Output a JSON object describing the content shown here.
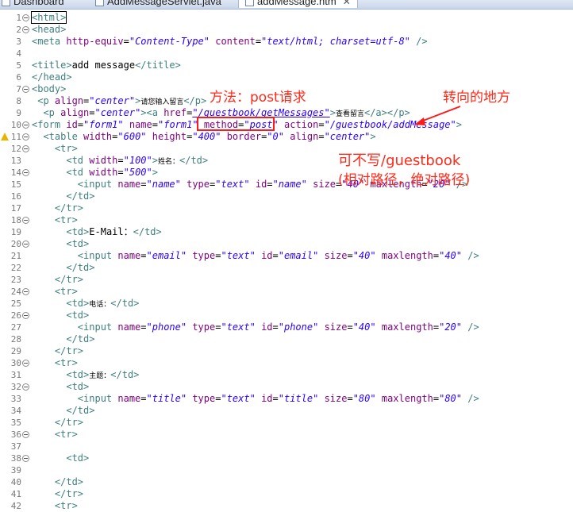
{
  "tabs": [
    {
      "label": "Dashboard",
      "active": false
    },
    {
      "label": "AddMessageServlet.java",
      "active": false
    },
    {
      "label": "addMessage.htm",
      "active": true,
      "close": "✕"
    }
  ],
  "lines": [
    {
      "n": "1",
      "fold": true,
      "segs": [
        {
          "c": "t",
          "x": "<html>"
        }
      ]
    },
    {
      "n": "2",
      "fold": true,
      "segs": [
        {
          "c": "t",
          "x": "<head>"
        }
      ]
    },
    {
      "n": "3",
      "segs": [
        {
          "c": "t",
          "x": "<meta "
        },
        {
          "c": "a",
          "x": "http-equiv"
        },
        {
          "c": "tx",
          "x": "="
        },
        {
          "c": "v",
          "x": "\"Content-Type\""
        },
        {
          "c": "tx",
          "x": " "
        },
        {
          "c": "a",
          "x": "content"
        },
        {
          "c": "tx",
          "x": "="
        },
        {
          "c": "v",
          "x": "\"text/html; charset=utf-8\""
        },
        {
          "c": "t",
          "x": " />"
        }
      ]
    },
    {
      "n": "4",
      "segs": []
    },
    {
      "n": "5",
      "segs": [
        {
          "c": "t",
          "x": "<title>"
        },
        {
          "c": "tx",
          "x": "add message"
        },
        {
          "c": "t",
          "x": "</title>"
        }
      ]
    },
    {
      "n": "6",
      "segs": [
        {
          "c": "t",
          "x": "</head>"
        }
      ]
    },
    {
      "n": "7",
      "fold": true,
      "segs": [
        {
          "c": "t",
          "x": "<body>"
        }
      ]
    },
    {
      "n": "8",
      "segs": [
        {
          "c": "tx",
          "x": " "
        },
        {
          "c": "t",
          "x": "<p "
        },
        {
          "c": "a",
          "x": "align"
        },
        {
          "c": "tx",
          "x": "="
        },
        {
          "c": "v",
          "x": "\"center\""
        },
        {
          "c": "t",
          "x": ">"
        },
        {
          "c": "tx sm",
          "x": "请您输入留言"
        },
        {
          "c": "t",
          "x": "</p>"
        }
      ]
    },
    {
      "n": "9",
      "segs": [
        {
          "c": "tx",
          "x": "  "
        },
        {
          "c": "t",
          "x": "<p "
        },
        {
          "c": "a",
          "x": "align"
        },
        {
          "c": "tx",
          "x": "="
        },
        {
          "c": "v",
          "x": "\"center\""
        },
        {
          "c": "t",
          "x": "><a "
        },
        {
          "c": "a",
          "x": "href"
        },
        {
          "c": "tx",
          "x": "="
        },
        {
          "c": "v ul",
          "x": "\"/guestbook/getMessages\""
        },
        {
          "c": "t",
          "x": ">"
        },
        {
          "c": "tx sm",
          "x": "查看留言"
        },
        {
          "c": "t",
          "x": "</a></p>"
        }
      ]
    },
    {
      "n": "10",
      "fold": true,
      "segs": [
        {
          "c": "t",
          "x": "<form "
        },
        {
          "c": "a",
          "x": "id"
        },
        {
          "c": "tx",
          "x": "="
        },
        {
          "c": "v",
          "x": "\"form1\""
        },
        {
          "c": "tx",
          "x": " "
        },
        {
          "c": "a",
          "x": "name"
        },
        {
          "c": "tx",
          "x": "="
        },
        {
          "c": "v",
          "x": "\"form1\""
        },
        {
          "c": "tx",
          "x": " "
        },
        {
          "c": "a",
          "x": "method"
        },
        {
          "c": "tx",
          "x": "="
        },
        {
          "c": "v",
          "x": "\"post\""
        },
        {
          "c": "tx",
          "x": " "
        },
        {
          "c": "a",
          "x": "action"
        },
        {
          "c": "tx",
          "x": "="
        },
        {
          "c": "v",
          "x": "\"/guestbook/addMessage\""
        },
        {
          "c": "t",
          "x": ">"
        }
      ]
    },
    {
      "n": "11",
      "fold": true,
      "warn": true,
      "segs": [
        {
          "c": "tx",
          "x": "  "
        },
        {
          "c": "t",
          "x": "<table "
        },
        {
          "c": "a",
          "x": "width"
        },
        {
          "c": "tx",
          "x": "="
        },
        {
          "c": "v",
          "x": "\"600\""
        },
        {
          "c": "tx",
          "x": " "
        },
        {
          "c": "a",
          "x": "height"
        },
        {
          "c": "tx",
          "x": "="
        },
        {
          "c": "v",
          "x": "\"400\""
        },
        {
          "c": "tx",
          "x": " "
        },
        {
          "c": "a",
          "x": "border"
        },
        {
          "c": "tx",
          "x": "="
        },
        {
          "c": "v",
          "x": "\"0\""
        },
        {
          "c": "tx",
          "x": " "
        },
        {
          "c": "a",
          "x": "align"
        },
        {
          "c": "tx",
          "x": "="
        },
        {
          "c": "v",
          "x": "\"center\""
        },
        {
          "c": "t",
          "x": ">"
        }
      ]
    },
    {
      "n": "12",
      "fold": true,
      "segs": [
        {
          "c": "tx",
          "x": "    "
        },
        {
          "c": "t",
          "x": "<tr>"
        }
      ]
    },
    {
      "n": "13",
      "segs": [
        {
          "c": "tx",
          "x": "      "
        },
        {
          "c": "t",
          "x": "<td "
        },
        {
          "c": "a",
          "x": "width"
        },
        {
          "c": "tx",
          "x": "="
        },
        {
          "c": "v",
          "x": "\"100\""
        },
        {
          "c": "t",
          "x": ">"
        },
        {
          "c": "tx sm",
          "x": "姓名："
        },
        {
          "c": "t",
          "x": "</td>"
        }
      ]
    },
    {
      "n": "14",
      "fold": true,
      "segs": [
        {
          "c": "tx",
          "x": "      "
        },
        {
          "c": "t",
          "x": "<td "
        },
        {
          "c": "a",
          "x": "width"
        },
        {
          "c": "tx",
          "x": "="
        },
        {
          "c": "v",
          "x": "\"500\""
        },
        {
          "c": "t",
          "x": ">"
        }
      ]
    },
    {
      "n": "15",
      "segs": [
        {
          "c": "tx",
          "x": "        "
        },
        {
          "c": "t",
          "x": "<input "
        },
        {
          "c": "a",
          "x": "name"
        },
        {
          "c": "tx",
          "x": "="
        },
        {
          "c": "v",
          "x": "\"name\""
        },
        {
          "c": "tx",
          "x": " "
        },
        {
          "c": "a",
          "x": "type"
        },
        {
          "c": "tx",
          "x": "="
        },
        {
          "c": "v",
          "x": "\"text\""
        },
        {
          "c": "tx",
          "x": " "
        },
        {
          "c": "a",
          "x": "id"
        },
        {
          "c": "tx",
          "x": "="
        },
        {
          "c": "v",
          "x": "\"name\""
        },
        {
          "c": "tx",
          "x": " "
        },
        {
          "c": "a",
          "x": "size"
        },
        {
          "c": "tx",
          "x": "="
        },
        {
          "c": "v",
          "x": "\"40\""
        },
        {
          "c": "tx",
          "x": " "
        },
        {
          "c": "a",
          "x": "maxlength"
        },
        {
          "c": "tx",
          "x": "="
        },
        {
          "c": "v",
          "x": "\"20\""
        },
        {
          "c": "t",
          "x": " />"
        }
      ]
    },
    {
      "n": "16",
      "segs": [
        {
          "c": "tx",
          "x": "      "
        },
        {
          "c": "t",
          "x": "</td>"
        }
      ]
    },
    {
      "n": "17",
      "segs": [
        {
          "c": "tx",
          "x": "    "
        },
        {
          "c": "t",
          "x": "</tr>"
        }
      ]
    },
    {
      "n": "18",
      "fold": true,
      "segs": [
        {
          "c": "tx",
          "x": "    "
        },
        {
          "c": "t",
          "x": "<tr>"
        }
      ]
    },
    {
      "n": "19",
      "segs": [
        {
          "c": "tx",
          "x": "      "
        },
        {
          "c": "t",
          "x": "<td>"
        },
        {
          "c": "tx",
          "x": "E-Mail："
        },
        {
          "c": "t",
          "x": "</td>"
        }
      ]
    },
    {
      "n": "20",
      "fold": true,
      "segs": [
        {
          "c": "tx",
          "x": "      "
        },
        {
          "c": "t",
          "x": "<td>"
        }
      ]
    },
    {
      "n": "21",
      "segs": [
        {
          "c": "tx",
          "x": "        "
        },
        {
          "c": "t",
          "x": "<input "
        },
        {
          "c": "a",
          "x": "name"
        },
        {
          "c": "tx",
          "x": "="
        },
        {
          "c": "v",
          "x": "\"email\""
        },
        {
          "c": "tx",
          "x": " "
        },
        {
          "c": "a",
          "x": "type"
        },
        {
          "c": "tx",
          "x": "="
        },
        {
          "c": "v",
          "x": "\"text\""
        },
        {
          "c": "tx",
          "x": " "
        },
        {
          "c": "a",
          "x": "id"
        },
        {
          "c": "tx",
          "x": "="
        },
        {
          "c": "v",
          "x": "\"email\""
        },
        {
          "c": "tx",
          "x": " "
        },
        {
          "c": "a",
          "x": "size"
        },
        {
          "c": "tx",
          "x": "="
        },
        {
          "c": "v",
          "x": "\"40\""
        },
        {
          "c": "tx",
          "x": " "
        },
        {
          "c": "a",
          "x": "maxlength"
        },
        {
          "c": "tx",
          "x": "="
        },
        {
          "c": "v",
          "x": "\"40\""
        },
        {
          "c": "t",
          "x": " />"
        }
      ]
    },
    {
      "n": "22",
      "segs": [
        {
          "c": "tx",
          "x": "      "
        },
        {
          "c": "t",
          "x": "</td>"
        }
      ]
    },
    {
      "n": "23",
      "segs": [
        {
          "c": "tx",
          "x": "    "
        },
        {
          "c": "t",
          "x": "</tr>"
        }
      ]
    },
    {
      "n": "24",
      "fold": true,
      "segs": [
        {
          "c": "tx",
          "x": "    "
        },
        {
          "c": "t",
          "x": "<tr>"
        }
      ]
    },
    {
      "n": "25",
      "segs": [
        {
          "c": "tx",
          "x": "      "
        },
        {
          "c": "t",
          "x": "<td>"
        },
        {
          "c": "tx sm",
          "x": "电话："
        },
        {
          "c": "t",
          "x": "</td>"
        }
      ]
    },
    {
      "n": "26",
      "fold": true,
      "segs": [
        {
          "c": "tx",
          "x": "      "
        },
        {
          "c": "t",
          "x": "<td>"
        }
      ]
    },
    {
      "n": "27",
      "segs": [
        {
          "c": "tx",
          "x": "        "
        },
        {
          "c": "t",
          "x": "<input "
        },
        {
          "c": "a",
          "x": "name"
        },
        {
          "c": "tx",
          "x": "="
        },
        {
          "c": "v",
          "x": "\"phone\""
        },
        {
          "c": "tx",
          "x": " "
        },
        {
          "c": "a",
          "x": "type"
        },
        {
          "c": "tx",
          "x": "="
        },
        {
          "c": "v",
          "x": "\"text\""
        },
        {
          "c": "tx",
          "x": " "
        },
        {
          "c": "a",
          "x": "id"
        },
        {
          "c": "tx",
          "x": "="
        },
        {
          "c": "v",
          "x": "\"phone\""
        },
        {
          "c": "tx",
          "x": " "
        },
        {
          "c": "a",
          "x": "size"
        },
        {
          "c": "tx",
          "x": "="
        },
        {
          "c": "v",
          "x": "\"40\""
        },
        {
          "c": "tx",
          "x": " "
        },
        {
          "c": "a",
          "x": "maxlength"
        },
        {
          "c": "tx",
          "x": "="
        },
        {
          "c": "v",
          "x": "\"20\""
        },
        {
          "c": "t",
          "x": " />"
        }
      ]
    },
    {
      "n": "28",
      "segs": [
        {
          "c": "tx",
          "x": "      "
        },
        {
          "c": "t",
          "x": "</td>"
        }
      ]
    },
    {
      "n": "29",
      "segs": [
        {
          "c": "tx",
          "x": "    "
        },
        {
          "c": "t",
          "x": "</tr>"
        }
      ]
    },
    {
      "n": "30",
      "fold": true,
      "segs": [
        {
          "c": "tx",
          "x": "    "
        },
        {
          "c": "t",
          "x": "<tr>"
        }
      ]
    },
    {
      "n": "31",
      "segs": [
        {
          "c": "tx",
          "x": "      "
        },
        {
          "c": "t",
          "x": "<td>"
        },
        {
          "c": "tx sm",
          "x": "主题："
        },
        {
          "c": "t",
          "x": "</td>"
        }
      ]
    },
    {
      "n": "32",
      "fold": true,
      "segs": [
        {
          "c": "tx",
          "x": "      "
        },
        {
          "c": "t",
          "x": "<td>"
        }
      ]
    },
    {
      "n": "33",
      "segs": [
        {
          "c": "tx",
          "x": "        "
        },
        {
          "c": "t",
          "x": "<input "
        },
        {
          "c": "a",
          "x": "name"
        },
        {
          "c": "tx",
          "x": "="
        },
        {
          "c": "v",
          "x": "\"title\""
        },
        {
          "c": "tx",
          "x": " "
        },
        {
          "c": "a",
          "x": "type"
        },
        {
          "c": "tx",
          "x": "="
        },
        {
          "c": "v",
          "x": "\"text\""
        },
        {
          "c": "tx",
          "x": " "
        },
        {
          "c": "a",
          "x": "id"
        },
        {
          "c": "tx",
          "x": "="
        },
        {
          "c": "v",
          "x": "\"title\""
        },
        {
          "c": "tx",
          "x": " "
        },
        {
          "c": "a",
          "x": "size"
        },
        {
          "c": "tx",
          "x": "="
        },
        {
          "c": "v",
          "x": "\"80\""
        },
        {
          "c": "tx",
          "x": " "
        },
        {
          "c": "a",
          "x": "maxlength"
        },
        {
          "c": "tx",
          "x": "="
        },
        {
          "c": "v",
          "x": "\"80\""
        },
        {
          "c": "t",
          "x": " />"
        }
      ]
    },
    {
      "n": "34",
      "segs": [
        {
          "c": "tx",
          "x": "      "
        },
        {
          "c": "t",
          "x": "</td>"
        }
      ]
    },
    {
      "n": "35",
      "segs": [
        {
          "c": "tx",
          "x": "    "
        },
        {
          "c": "t",
          "x": "</tr>"
        }
      ]
    },
    {
      "n": "36",
      "fold": true,
      "segs": [
        {
          "c": "tx",
          "x": "    "
        },
        {
          "c": "t",
          "x": "<tr>"
        }
      ]
    },
    {
      "n": "37",
      "segs": []
    },
    {
      "n": "38",
      "fold": true,
      "segs": [
        {
          "c": "tx",
          "x": "      "
        },
        {
          "c": "t",
          "x": "<td>"
        }
      ]
    },
    {
      "n": "39",
      "segs": []
    },
    {
      "n": "40",
      "segs": [
        {
          "c": "tx",
          "x": "    "
        },
        {
          "c": "t",
          "x": "</td>"
        }
      ]
    },
    {
      "n": "41",
      "segs": [
        {
          "c": "tx",
          "x": "    "
        },
        {
          "c": "t",
          "x": "</tr>"
        }
      ]
    },
    {
      "n": "42",
      "segs": [
        {
          "c": "tx",
          "x": "    "
        },
        {
          "c": "t",
          "x": "<tr>"
        }
      ]
    }
  ],
  "annotations": {
    "method_label": "方法：post请求",
    "forward_label": "转向的地方",
    "optional_line1": "可不写/guestbook",
    "optional_line2": "(相对路径，绝对路径)"
  },
  "colors": {
    "tag": "#3f7f7f",
    "attribute": "#7f007f",
    "value": "#2a00ff",
    "annotation": "#ff2a1a"
  }
}
